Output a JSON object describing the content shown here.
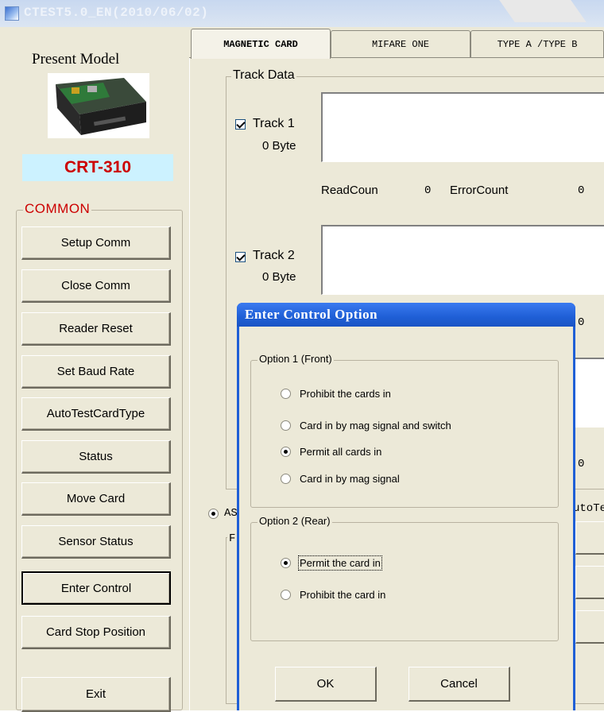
{
  "window": {
    "title": "CTEST5.0_EN(2010/06/02)"
  },
  "left": {
    "present_model_label": "Present Model",
    "model_name": "CRT-310",
    "common_legend": "COMMON",
    "buttons": [
      "Setup Comm",
      "Close Comm",
      "Reader Reset",
      "Set Baud Rate",
      "AutoTestCardType",
      "Status",
      "Move Card",
      "Sensor Status",
      "Enter Control",
      "Card Stop Position",
      "Exit"
    ]
  },
  "tabs": [
    "MAGNETIC CARD",
    "MIFARE ONE",
    "TYPE A /TYPE B"
  ],
  "track_data": {
    "legend": "Track Data",
    "track1": {
      "label": "Track 1",
      "bytes": "0 Byte",
      "checked": true
    },
    "track2": {
      "label": "Track 2",
      "bytes": "0 Byte",
      "checked": true
    },
    "read_count_label": "ReadCoun",
    "read_count_value": "0",
    "error_count_label": "ErrorCount",
    "error_count_value": "0",
    "partial_values": [
      "0",
      "0"
    ],
    "partial_radio_label": "AS",
    "partial_auto_label": "utoTe",
    "partial_group_char": "F"
  },
  "dialog": {
    "title": "Enter Control Option",
    "option1": {
      "legend": "Option 1 (Front)",
      "items": [
        {
          "label": "Prohibit the cards in",
          "selected": false
        },
        {
          "label": "Card in by mag signal and  switch",
          "selected": false
        },
        {
          "label": "Permit all cards in",
          "selected": true
        },
        {
          "label": "Card in by mag signal",
          "selected": false
        }
      ]
    },
    "option2": {
      "legend": "Option 2 (Rear)",
      "items": [
        {
          "label": "Permit the card in",
          "selected": true
        },
        {
          "label": "Prohibit the card in",
          "selected": false
        }
      ]
    },
    "ok_label": "OK",
    "cancel_label": "Cancel"
  },
  "colors": {
    "model_text": "#cc0000",
    "model_bg": "#ccf2ff",
    "dialog_title": "#1f5fd6",
    "face": "#ece9d8"
  }
}
